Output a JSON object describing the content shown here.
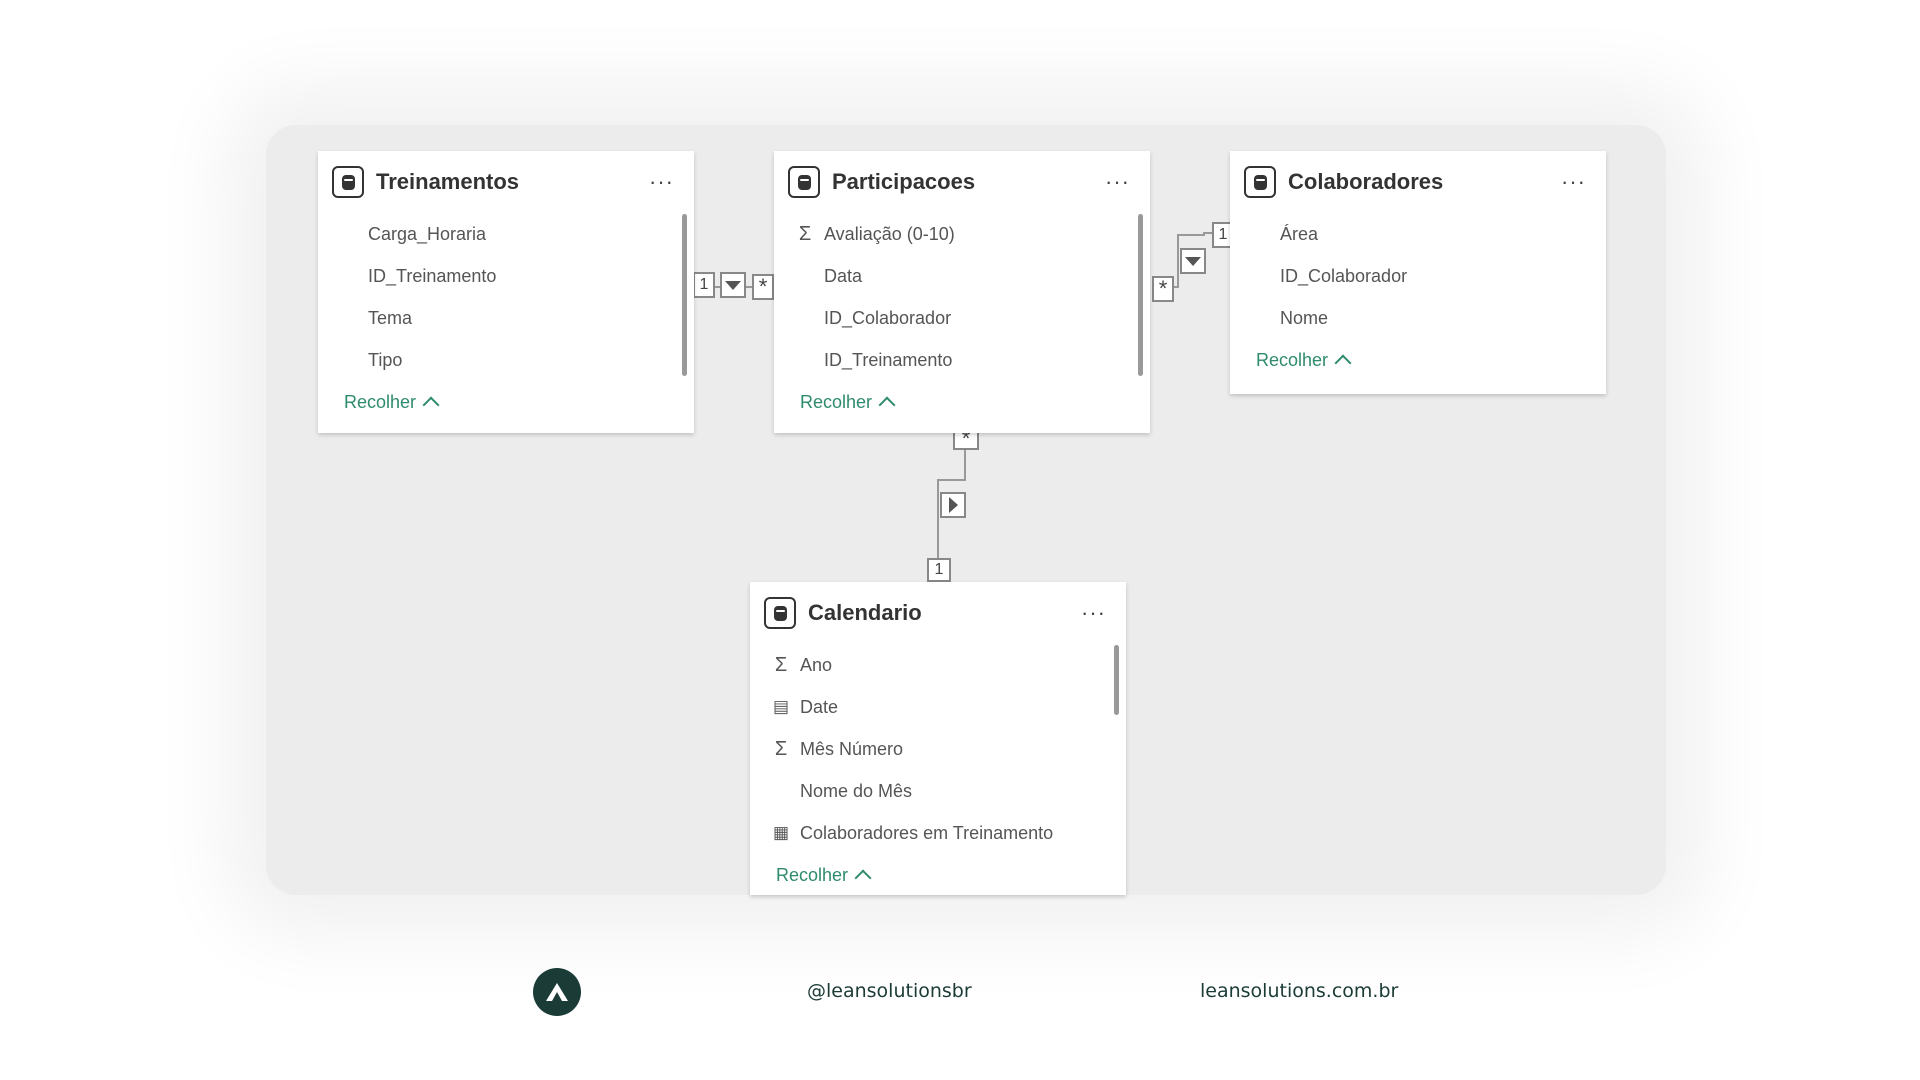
{
  "tables": {
    "treinamentos": {
      "title": "Treinamentos",
      "more": "···",
      "fields": [
        {
          "name": "Carga_Horaria",
          "icon": ""
        },
        {
          "name": "ID_Treinamento",
          "icon": ""
        },
        {
          "name": "Tema",
          "icon": ""
        },
        {
          "name": "Tipo",
          "icon": ""
        }
      ],
      "collapse_label": "Recolher"
    },
    "participacoes": {
      "title": "Participacoes",
      "more": "···",
      "fields": [
        {
          "name": "Avaliação (0-10)",
          "icon": "sum-icon"
        },
        {
          "name": "Data",
          "icon": ""
        },
        {
          "name": "ID_Colaborador",
          "icon": ""
        },
        {
          "name": "ID_Treinamento",
          "icon": ""
        }
      ],
      "collapse_label": "Recolher"
    },
    "colaboradores": {
      "title": "Colaboradores",
      "more": "···",
      "fields": [
        {
          "name": "Área",
          "icon": ""
        },
        {
          "name": "ID_Colaborador",
          "icon": ""
        },
        {
          "name": "Nome",
          "icon": ""
        }
      ],
      "collapse_label": "Recolher"
    },
    "calendario": {
      "title": "Calendario",
      "more": "···",
      "fields": [
        {
          "name": "Ano",
          "icon": "sum-icon"
        },
        {
          "name": "Date",
          "icon": "calendar-icon"
        },
        {
          "name": "Mês Número",
          "icon": "sum-icon"
        },
        {
          "name": "Nome do Mês",
          "icon": ""
        },
        {
          "name": "Colaboradores em Treinamento",
          "icon": "measure-icon"
        }
      ],
      "collapse_label": "Recolher"
    }
  },
  "relationships": {
    "treinamentos_participacoes": {
      "one": "1",
      "many": "*"
    },
    "colaboradores_participacoes": {
      "one": "1",
      "many": "*"
    },
    "calendario_participacoes": {
      "one": "1",
      "many": "*"
    }
  },
  "footer": {
    "handle": "@leansolutionsbr",
    "website": "leansolutions.com.br"
  },
  "colors": {
    "accent": "#2e8b6e",
    "brand": "#1b3b36",
    "canvas": "#ececec"
  }
}
